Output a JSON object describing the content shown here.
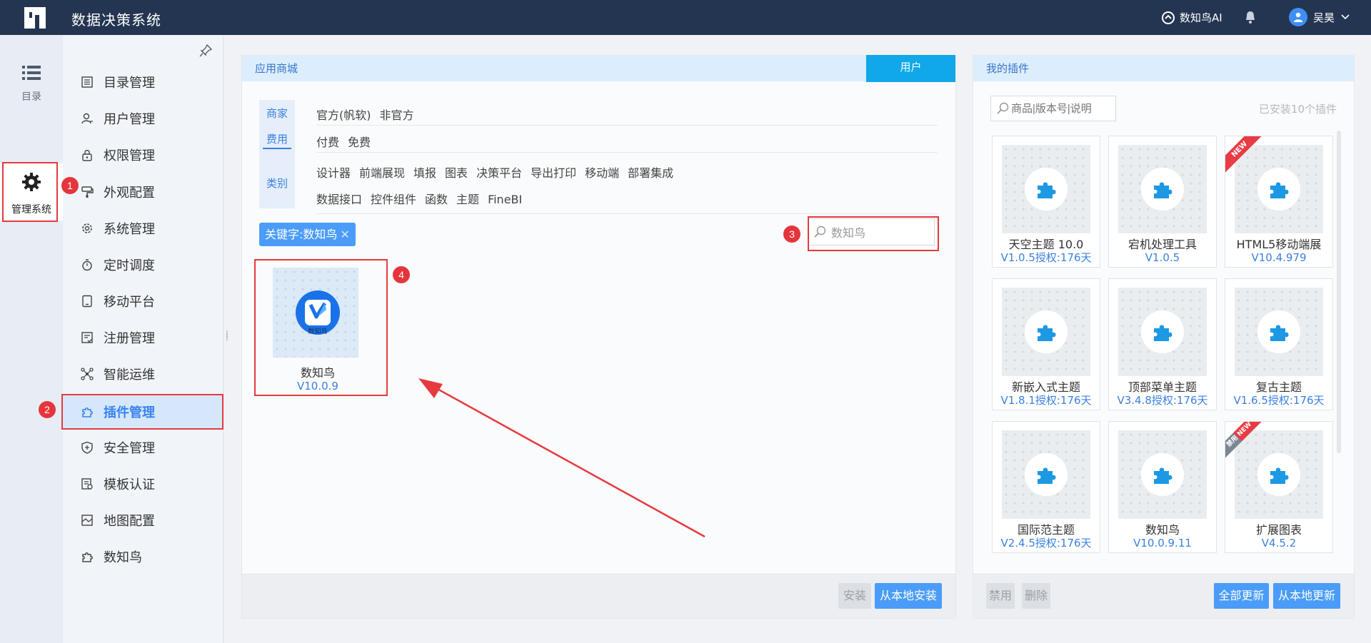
{
  "header": {
    "title": "数据决策系统",
    "ai_label": "数知鸟AI",
    "user_name": "吴昊"
  },
  "rail": [
    {
      "label": "目录",
      "icon": "list-icon"
    },
    {
      "label": "管理系统",
      "icon": "gear-icon",
      "active": true
    }
  ],
  "menu": {
    "items": [
      {
        "label": "目录管理",
        "icon": "catalog-icon"
      },
      {
        "label": "用户管理",
        "icon": "user-icon"
      },
      {
        "label": "权限管理",
        "icon": "lock-icon"
      },
      {
        "label": "外观配置",
        "icon": "brush-icon"
      },
      {
        "label": "系统管理",
        "icon": "gear-icon"
      },
      {
        "label": "定时调度",
        "icon": "timer-icon"
      },
      {
        "label": "移动平台",
        "icon": "tablet-icon"
      },
      {
        "label": "注册管理",
        "icon": "register-icon"
      },
      {
        "label": "智能运维",
        "icon": "network-icon"
      },
      {
        "label": "插件管理",
        "icon": "puzzle-icon",
        "active": true
      },
      {
        "label": "安全管理",
        "icon": "shield-icon"
      },
      {
        "label": "模板认证",
        "icon": "template-icon"
      },
      {
        "label": "地图配置",
        "icon": "map-icon"
      },
      {
        "label": "数知鸟",
        "icon": "puzzle-icon"
      }
    ]
  },
  "store": {
    "title": "应用商城",
    "user_tab": "用户",
    "filter_labels": [
      "商家",
      "费用",
      "类别"
    ],
    "vendor_options": [
      "官方(帆软)",
      "非官方"
    ],
    "fee_options": [
      "付费",
      "免费"
    ],
    "category_row1": [
      "设计器",
      "前端展现",
      "填报",
      "图表",
      "决策平台",
      "导出打印",
      "移动端",
      "部署集成"
    ],
    "category_row2": [
      "数据接口",
      "控件组件",
      "函数",
      "主题",
      "FineBI"
    ],
    "keyword_tag": "关键字:数知鸟",
    "search_value": "数知鸟",
    "result": {
      "name": "数知鸟",
      "version": "V10.0.9",
      "logo_text": "数知鸟"
    },
    "install_button": "安装",
    "local_install_button": "从本地安装"
  },
  "my_plugins": {
    "title": "我的插件",
    "search_placeholder": "商品|版本号|说明",
    "installed_count": "已安装10个插件",
    "cards": [
      {
        "name": "天空主题 10.0",
        "version": "V1.0.5授权:176天",
        "ribbon": ""
      },
      {
        "name": "宕机处理工具",
        "version": "V1.0.5",
        "ribbon": ""
      },
      {
        "name": "HTML5移动端展",
        "version": "V10.4.979",
        "ribbon": "NEW"
      },
      {
        "name": "新嵌入式主题",
        "version": "V1.8.1授权:176天",
        "ribbon": ""
      },
      {
        "name": "顶部菜单主题",
        "version": "V3.4.8授权:176天",
        "ribbon": ""
      },
      {
        "name": "复古主题",
        "version": "V1.6.5授权:176天",
        "ribbon": ""
      },
      {
        "name": "国际范主题",
        "version": "V2.4.5授权:176天",
        "ribbon": ""
      },
      {
        "name": "数知鸟",
        "version": "V10.0.9.11",
        "ribbon": ""
      },
      {
        "name": "扩展图表",
        "version": "V4.5.2",
        "ribbon": "禁用 NEW"
      }
    ],
    "disable_button": "禁用",
    "delete_button": "删除",
    "update_all_button": "全部更新",
    "local_update_button": "从本地更新"
  },
  "annotations": [
    "1",
    "2",
    "3",
    "4"
  ],
  "colors": {
    "accent": "#4a9cf8",
    "header": "#243551",
    "annotation": "#e53a3f"
  }
}
